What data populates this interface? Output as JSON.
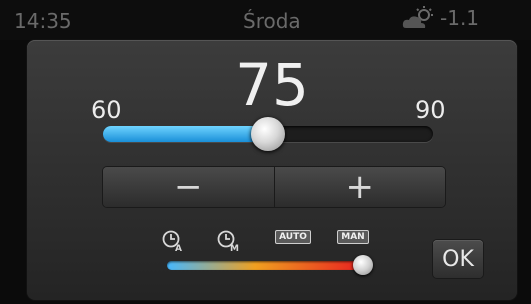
{
  "statusbar": {
    "time": "14:35",
    "day": "Środa",
    "temperature": "-1.1",
    "weather_icon": "cloud-sun-icon"
  },
  "thermostat": {
    "value": "75",
    "min": "60",
    "max": "90",
    "slider_fraction": 0.5
  },
  "stepper": {
    "minus_label": "−",
    "plus_label": "+"
  },
  "modes": {
    "auto_label": "AUTO",
    "man_label": "MAN",
    "clock_a_icon": "clock-a-icon",
    "clock_m_icon": "clock-m-icon",
    "selected_fraction": 1.0
  },
  "ok_label": "OK",
  "colors": {
    "fill": "#1a8fd8",
    "gradient": [
      "#46b8ff",
      "#f0a020",
      "#e82020"
    ]
  }
}
